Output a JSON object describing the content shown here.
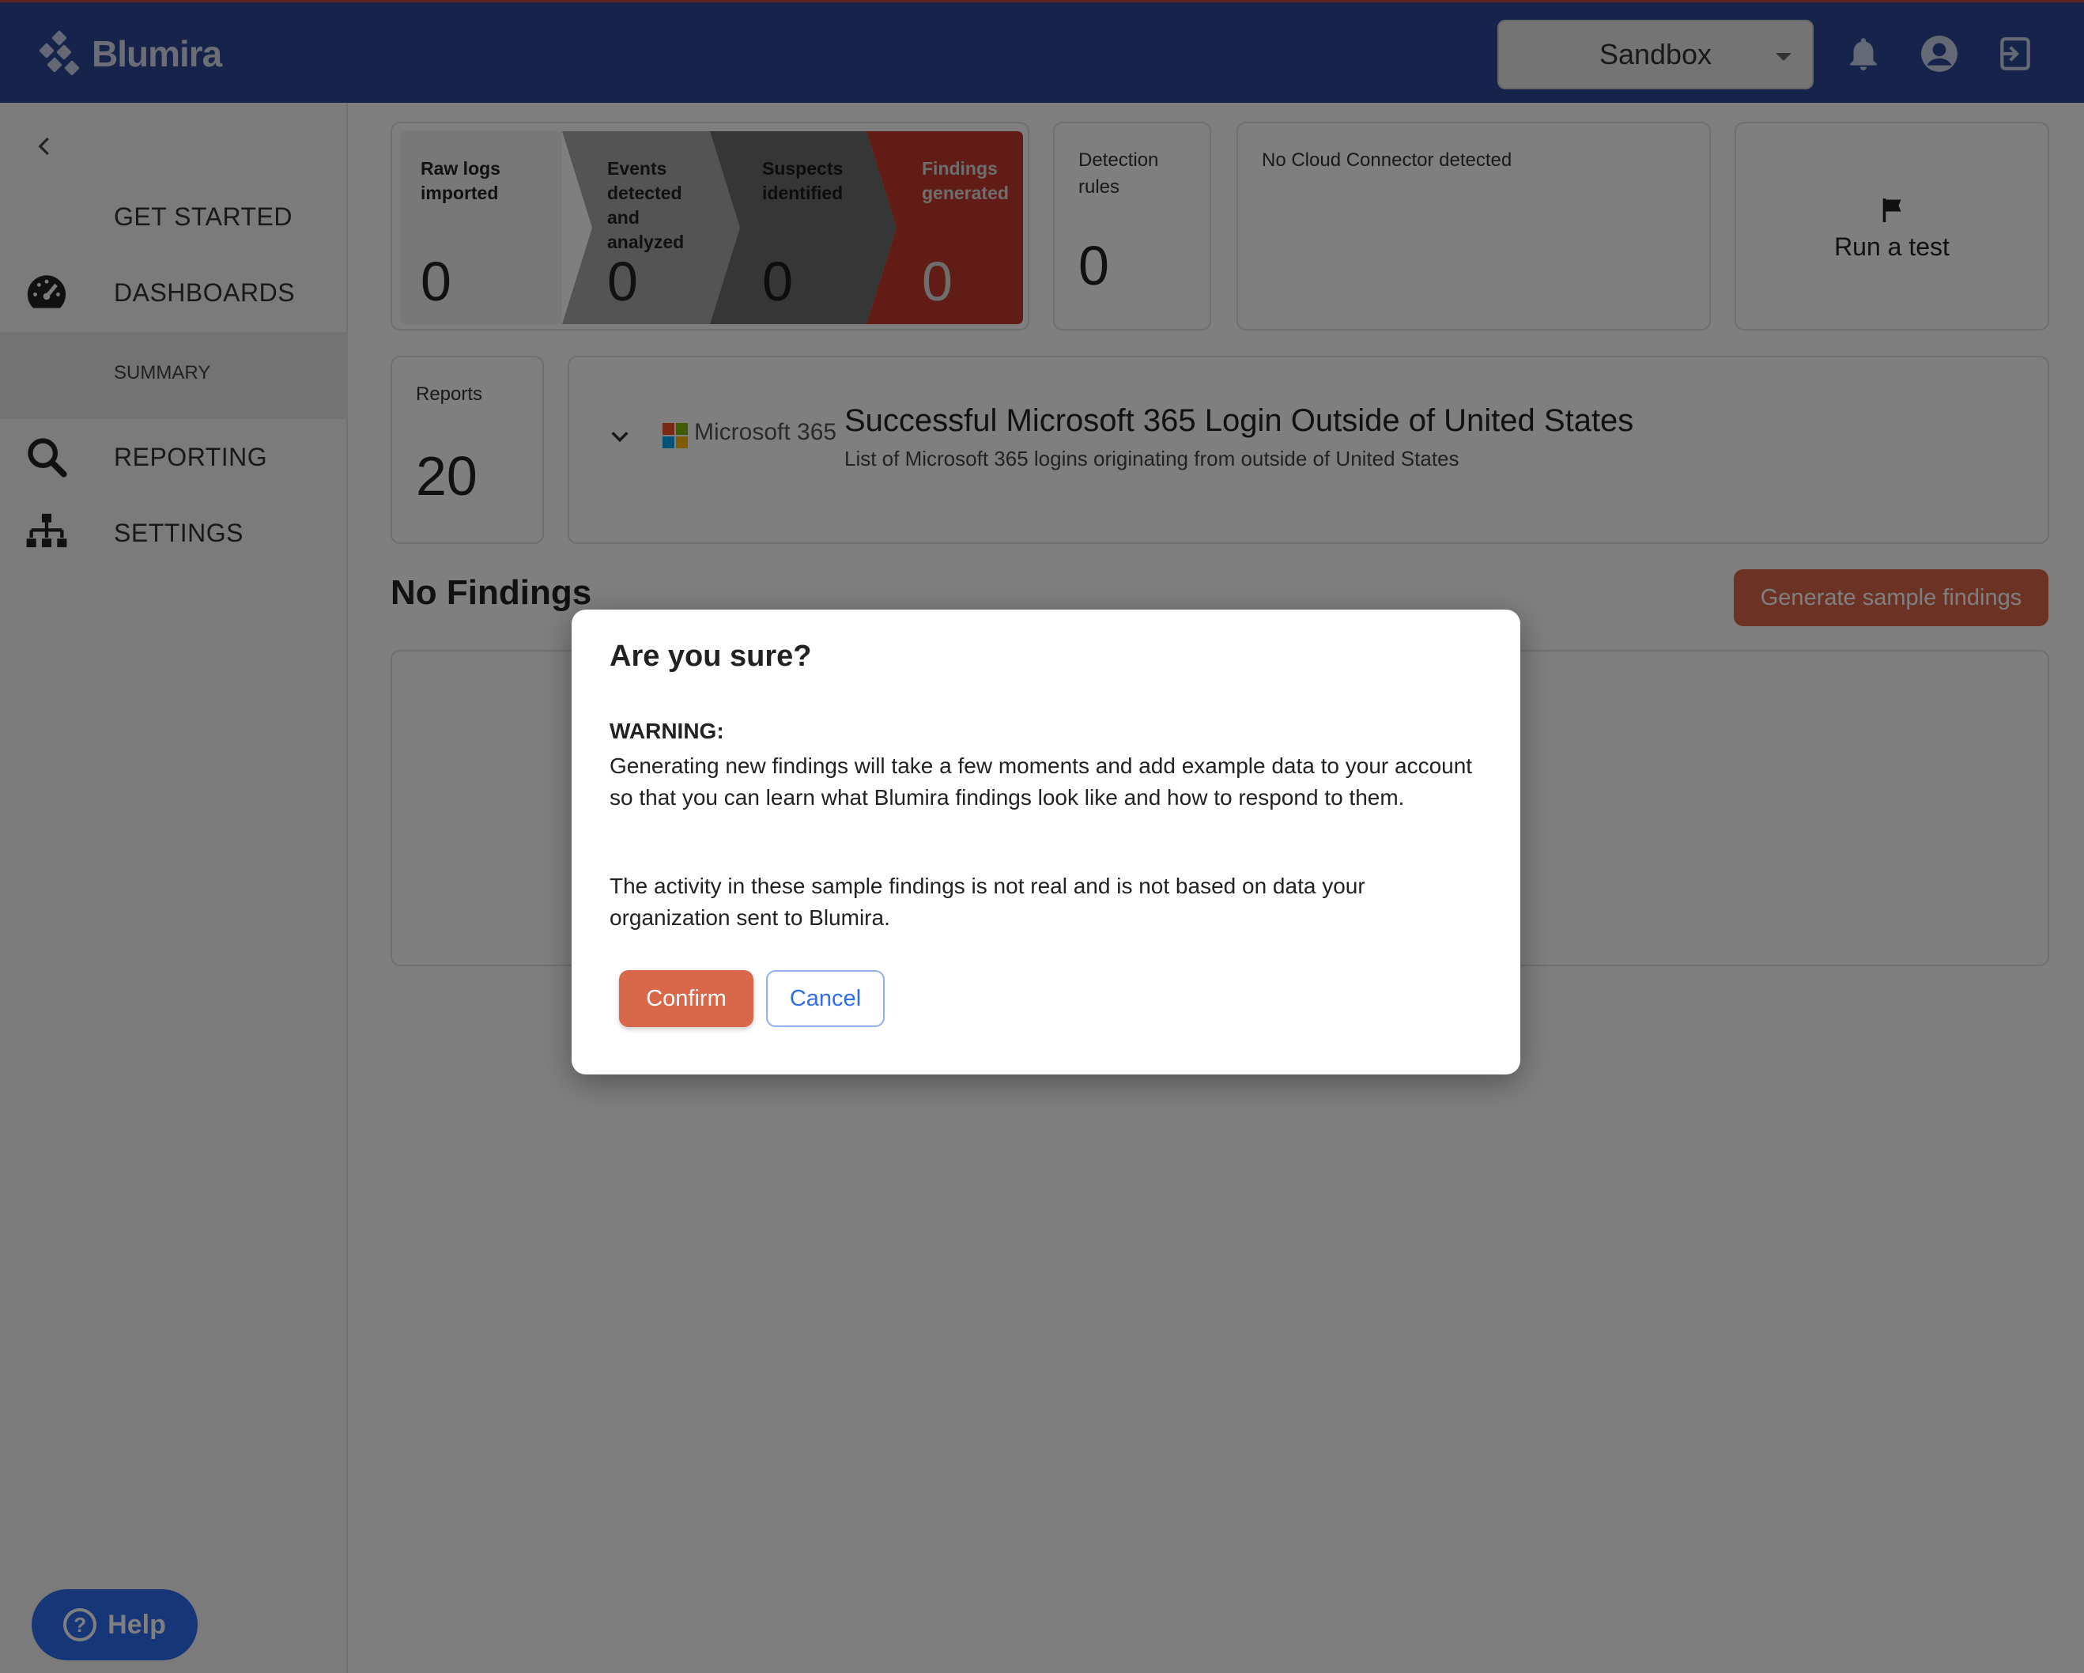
{
  "header": {
    "logo_text": "Blumira",
    "org_selector": "Sandbox",
    "icons": [
      "bell-icon",
      "user-icon",
      "logout-icon"
    ]
  },
  "sidebar": {
    "items": [
      {
        "label": "GET STARTED",
        "icon": "none"
      },
      {
        "label": "DASHBOARDS",
        "icon": "speedometer-icon"
      },
      {
        "label": "SUMMARY",
        "icon": "none"
      },
      {
        "label": "REPORTING",
        "icon": "search-icon"
      },
      {
        "label": "SETTINGS",
        "icon": "org-chart-icon"
      }
    ],
    "help_label": "Help"
  },
  "funnel": {
    "stages": [
      {
        "label": "Raw logs imported",
        "value": "0"
      },
      {
        "label": "Events detected and analyzed",
        "value": "0"
      },
      {
        "label": "Suspects identified",
        "value": "0"
      },
      {
        "label": "Findings generated",
        "value": "0"
      }
    ]
  },
  "detection": {
    "label": "Detection rules",
    "value": "0"
  },
  "cloud": {
    "label": "No Cloud Connector detected"
  },
  "test": {
    "label": "Run a test"
  },
  "reports": {
    "label": "Reports",
    "value": "20"
  },
  "rule": {
    "vendor": "Microsoft 365",
    "title": "Successful Microsoft 365 Login Outside of United States",
    "subtitle": "List of Microsoft 365 logins originating from outside of United States"
  },
  "findings": {
    "heading": "No Findings",
    "generate_label": "Generate sample findings"
  },
  "dialog": {
    "title": "Are you sure?",
    "warning": "WARNING:",
    "p1": "Generating new findings will take a few moments and add example data to your account so that you can learn what Blumira findings look like and how to respond to them.",
    "p2": "The activity in these sample findings is not real and is not based on data your organization sent to Blumira.",
    "confirm": "Confirm",
    "cancel": "Cancel"
  },
  "colors": {
    "header": "#2c4896",
    "accent": "#d9674a",
    "findings_stage": "#c0392b",
    "link": "#2f6df0"
  }
}
